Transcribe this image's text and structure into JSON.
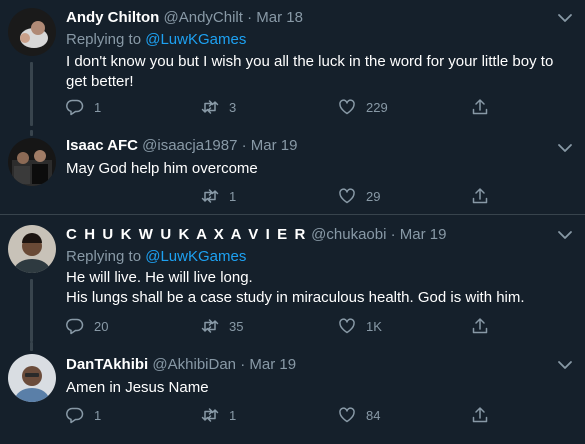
{
  "tweets": [
    {
      "name": "Andy Chilton",
      "handle": "@AndyChilt",
      "date": "Mar 18",
      "replying_prefix": "Replying to ",
      "replying_to": "@LuwKGames",
      "text": [
        "I don't know you but I wish you all the luck in the word for your little boy to get better!"
      ],
      "replies": "1",
      "retweets": "3",
      "likes": "229"
    },
    {
      "name": "Isaac AFC",
      "handle": "@isaacja1987",
      "date": "Mar 19",
      "text": [
        "May God help him overcome"
      ],
      "replies": "",
      "retweets": "1",
      "likes": "29"
    },
    {
      "name": "C H U K W U K A X A V I E R",
      "handle": "@chukaobi",
      "date": "Mar 19",
      "replying_prefix": "Replying to ",
      "replying_to": "@LuwKGames",
      "text": [
        "He will live. He will live long.",
        "His lungs shall be a case study in miraculous health. God is with him."
      ],
      "replies": "20",
      "retweets": "35",
      "likes": "1K"
    },
    {
      "name": "DanTAkhibi",
      "handle": "@AkhibiDan",
      "date": "Mar 19",
      "text": [
        "Amen in Jesus Name"
      ],
      "replies": "1",
      "retweets": "1",
      "likes": "84"
    }
  ],
  "separator": "·",
  "icons": {
    "reply": "reply-icon",
    "retweet": "retweet-icon",
    "like": "like-icon",
    "share": "share-icon",
    "more": "chevron-down-icon"
  },
  "colors": {
    "background": "#15202b",
    "secondary_text": "#8899a6",
    "link": "#1da1f2",
    "border": "#38444d"
  }
}
